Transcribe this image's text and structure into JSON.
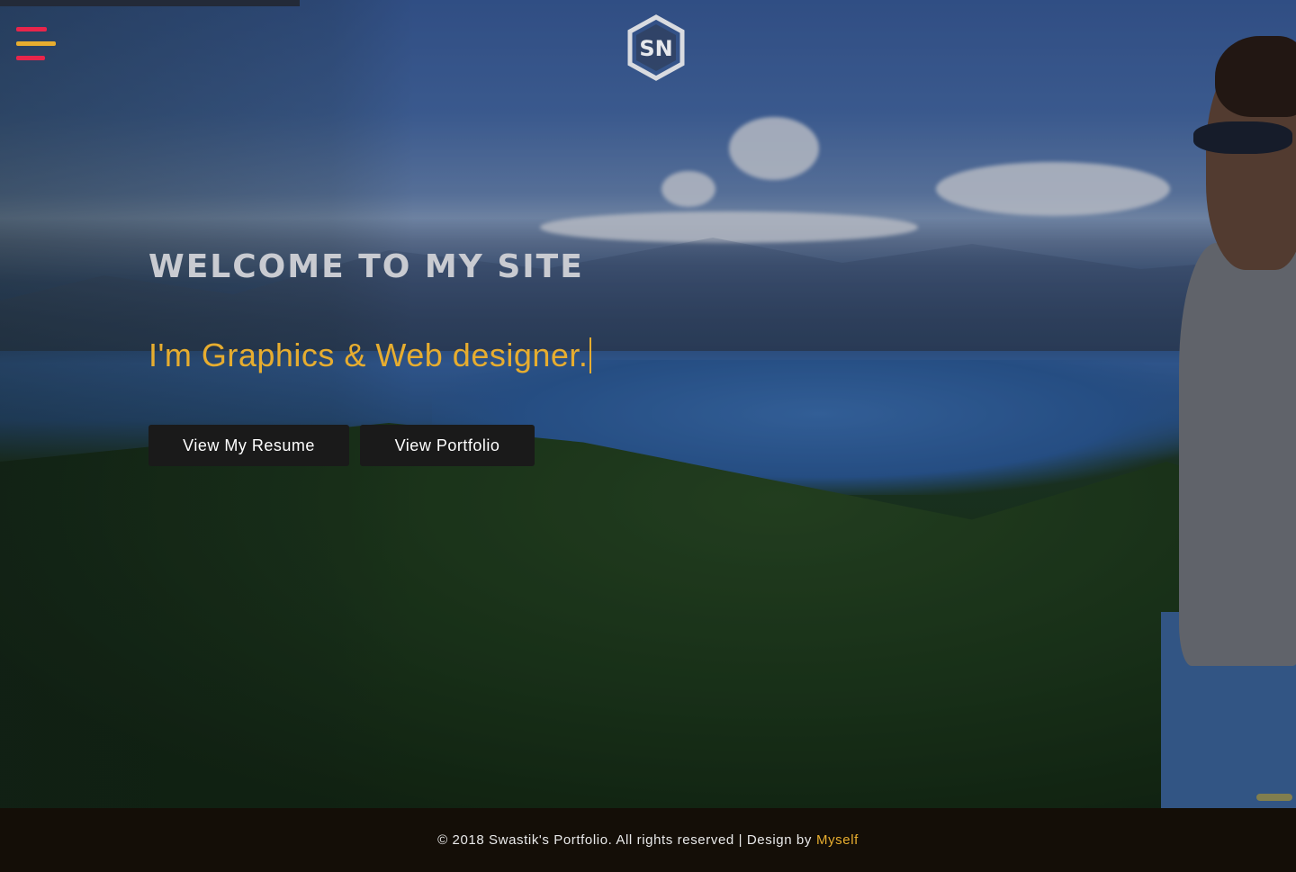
{
  "header": {
    "menu_icon": "hamburger-icon",
    "logo_text": "SN",
    "logo_icon": "hexagon-logo-icon"
  },
  "hero": {
    "welcome": "WELCOME TO MY SITE",
    "tagline": "I'm Graphics & Web designer.",
    "buttons": {
      "resume": "View My Resume",
      "portfolio": "View Portfolio"
    }
  },
  "footer": {
    "copyright": "© 2018 Swastik's Portfolio. All rights reserved | Design by",
    "link": "Myself"
  },
  "colors": {
    "accent": "#e7ad2f",
    "menu_red": "#e8254b",
    "menu_yellow": "#e7ad2f",
    "footer_bg": "#140e07",
    "button_bg": "#1a1a1a"
  }
}
